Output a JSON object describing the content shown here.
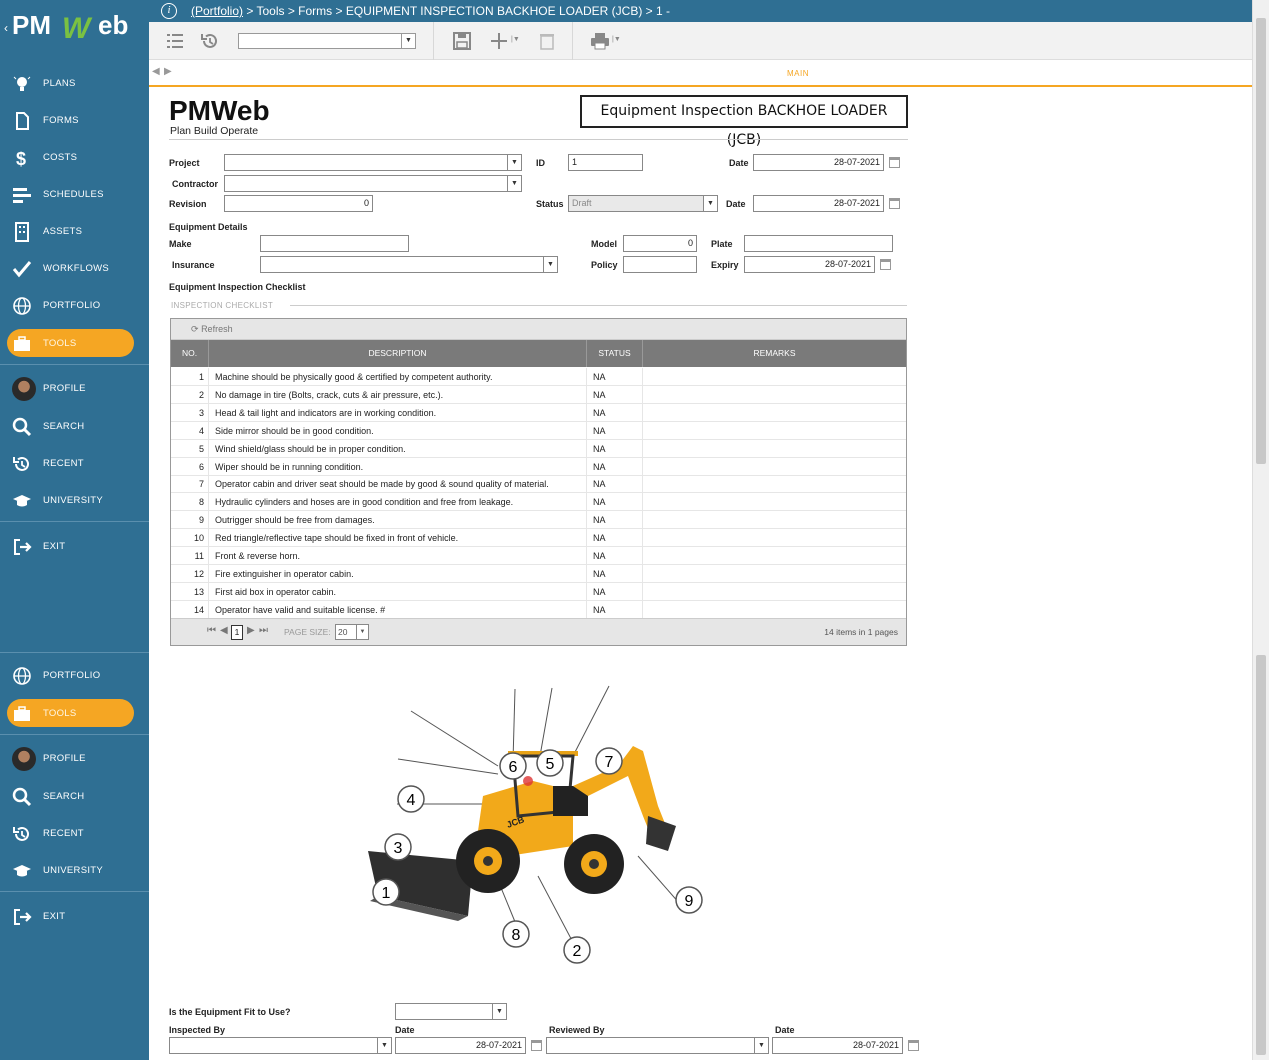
{
  "app": {
    "brand": "PMWeb",
    "accent": "#f5a623",
    "sidebar_color": "#2f6f93"
  },
  "breadcrumb": {
    "root": "(Portfolio)",
    "rest": " > Tools > Forms > EQUIPMENT INSPECTION BACKHOE LOADER (JCB) > 1 -"
  },
  "sidebar": {
    "plans": "PLANS",
    "forms": "FORMS",
    "costs": "COSTS",
    "schedules": "SCHEDULES",
    "assets": "ASSETS",
    "workflows": "WORKFLOWS",
    "portfolio": "PORTFOLIO",
    "tools": "TOOLS",
    "profile": "PROFILE",
    "search": "SEARCH",
    "recent": "RECENT",
    "university": "UNIVERSITY",
    "exit": "EXIT"
  },
  "tabs": {
    "main": "MAIN"
  },
  "form": {
    "logo_text": "PMWeb",
    "logo_tagline": "Plan Build Operate",
    "title": "Equipment Inspection BACKHOE LOADER (JCB)",
    "project_label": "Project",
    "project_value": "",
    "id_label": "ID",
    "id_value": "1",
    "date_label": "Date",
    "date_value": "28-07-2021",
    "contractor_label": "Contractor",
    "contractor_value": "",
    "revision_label": "Revision",
    "revision_value": "0",
    "status_label": "Status",
    "status_value": "Draft",
    "date2_label": "Date",
    "date2_value": "28-07-2021",
    "equipment_details": "Equipment Details",
    "make_label": "Make",
    "make_value": "",
    "model_label": "Model",
    "model_value": "0",
    "plate_label": "Plate",
    "plate_value": "",
    "insurance_label": "Insurance",
    "insurance_value": "",
    "policy_label": "Policy",
    "policy_value": "",
    "expiry_label": "Expiry",
    "expiry_value": "28-07-2021",
    "checklist_heading": "Equipment Inspection Checklist",
    "checklist_caption": "INSPECTION CHECKLIST",
    "fit_label": "Is the Equipment Fit to Use?",
    "fit_value": "",
    "inspected_by_label": "Inspected By",
    "inspected_by_value": "",
    "insp_date_label": "Date",
    "insp_date_value": "28-07-2021",
    "reviewed_by_label": "Reviewed By",
    "reviewed_by_value": "",
    "rev_date_label": "Date",
    "rev_date_value": "28-07-2021"
  },
  "grid": {
    "refresh": "Refresh",
    "headers": {
      "no": "NO.",
      "description": "DESCRIPTION",
      "status": "STATUS",
      "remarks": "REMARKS"
    },
    "rows": [
      {
        "no": "1",
        "description": "Machine should be physically good & certified by competent authority.",
        "status": "NA",
        "remarks": ""
      },
      {
        "no": "2",
        "description": "No damage in tire (Bolts, crack, cuts & air pressure, etc.).",
        "status": "NA",
        "remarks": ""
      },
      {
        "no": "3",
        "description": "Head & tail light and indicators are in working condition.",
        "status": "NA",
        "remarks": ""
      },
      {
        "no": "4",
        "description": "Side mirror should be in good condition.",
        "status": "NA",
        "remarks": ""
      },
      {
        "no": "5",
        "description": "Wind shield/glass should be in proper condition.",
        "status": "NA",
        "remarks": ""
      },
      {
        "no": "6",
        "description": "Wiper should be in running condition.",
        "status": "NA",
        "remarks": ""
      },
      {
        "no": "7",
        "description": "Operator cabin and driver seat should be made by good & sound quality of material.",
        "status": "NA",
        "remarks": ""
      },
      {
        "no": "8",
        "description": "Hydraulic cylinders and hoses are in good condition and free from leakage.",
        "status": "NA",
        "remarks": ""
      },
      {
        "no": "9",
        "description": "Outrigger should be free from damages.",
        "status": "NA",
        "remarks": ""
      },
      {
        "no": "10",
        "description": "Red triangle/reflective tape should be fixed in front of vehicle.",
        "status": "NA",
        "remarks": ""
      },
      {
        "no": "11",
        "description": "Front & reverse horn.",
        "status": "NA",
        "remarks": ""
      },
      {
        "no": "12",
        "description": "Fire extinguisher in operator cabin.",
        "status": "NA",
        "remarks": ""
      },
      {
        "no": "13",
        "description": "First aid box in operator cabin.",
        "status": "NA",
        "remarks": ""
      },
      {
        "no": "14",
        "description": "Operator have valid and suitable license. #",
        "status": "NA",
        "remarks": ""
      }
    ],
    "footer": {
      "page": "1",
      "page_size_label": "PAGE SIZE:",
      "page_size": "20",
      "summary": "14 items in 1 pages"
    }
  },
  "diagram": {
    "callouts": [
      "1",
      "2",
      "3",
      "4",
      "5",
      "6",
      "7",
      "8",
      "9"
    ],
    "machine_mark": "JCB"
  }
}
